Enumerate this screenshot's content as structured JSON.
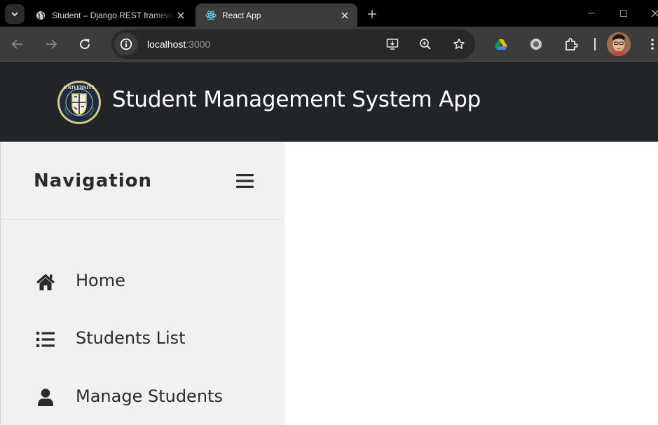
{
  "browser": {
    "tabs": [
      {
        "title": "Student – Django REST framework",
        "active": false,
        "favicon": "globe-icon"
      },
      {
        "title": "React App",
        "active": true,
        "favicon": "react-icon"
      }
    ],
    "url_host": "localhost",
    "url_port": ":3000"
  },
  "app": {
    "title": "Student Management System App",
    "logo_text": "UNIVERSITY"
  },
  "sidebar": {
    "title": "Navigation",
    "items": [
      {
        "label": "Home",
        "icon": "home-icon"
      },
      {
        "label": "Students List",
        "icon": "list-icon"
      },
      {
        "label": "Manage Students",
        "icon": "user-icon"
      }
    ]
  },
  "colors": {
    "header_bg": "#212529",
    "sidebar_bg": "#f1f1f1",
    "chrome_tabstrip": "#000000",
    "chrome_toolbar": "#3c3c3c"
  }
}
